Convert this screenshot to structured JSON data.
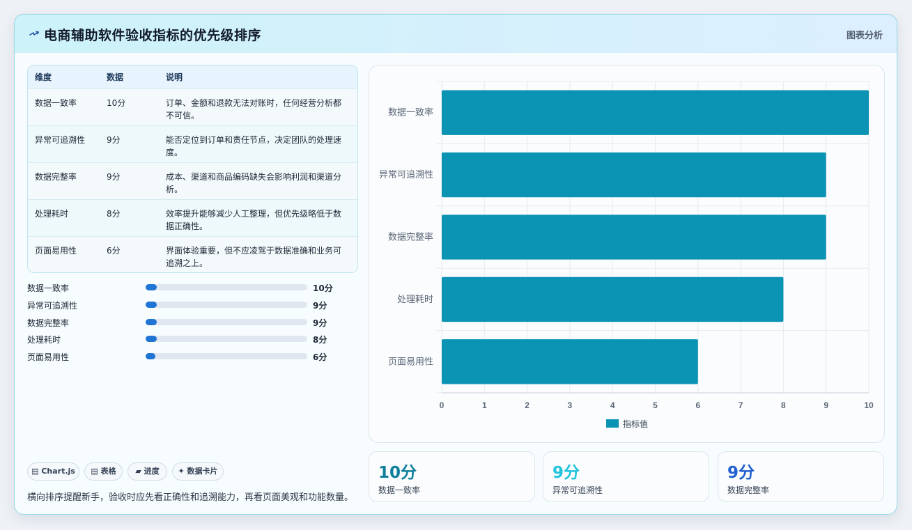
{
  "header": {
    "title": "电商辅助软件验收指标的优先级排序",
    "tag": "图表分析",
    "title_icon": "lightning-icon"
  },
  "table": {
    "headers": [
      "维度",
      "数据",
      "说明"
    ],
    "rows": [
      {
        "dimension": "数据一致率",
        "value": "10分",
        "desc": "订单、金额和退款无法对账时，任何经营分析都不可信。"
      },
      {
        "dimension": "异常可追溯性",
        "value": "9分",
        "desc": "能否定位到订单和责任节点，决定团队的处理速度。"
      },
      {
        "dimension": "数据完整率",
        "value": "9分",
        "desc": "成本、渠道和商品编码缺失会影响利润和渠道分析。"
      },
      {
        "dimension": "处理耗时",
        "value": "8分",
        "desc": "效率提升能够减少人工整理，但优先级略低于数据正确性。"
      },
      {
        "dimension": "页面易用性",
        "value": "6分",
        "desc": "界面体验重要，但不应凌驾于数据准确和业务可追溯之上。"
      }
    ]
  },
  "progress": [
    {
      "label": "数据一致率",
      "value": "10分",
      "fraction": 0.07
    },
    {
      "label": "异常可追溯性",
      "value": "9分",
      "fraction": 0.07
    },
    {
      "label": "数据完整率",
      "value": "9分",
      "fraction": 0.07
    },
    {
      "label": "处理耗时",
      "value": "8分",
      "fraction": 0.07
    },
    {
      "label": "页面易用性",
      "value": "6分",
      "fraction": 0.06
    }
  ],
  "chips": [
    "▤ Chart.js",
    "▤ 表格",
    "▰ 进度",
    "✦ 数据卡片"
  ],
  "footnote": "横向排序提醒新手，验收时应先看正确性和追溯能力，再看页面美观和功能数量。",
  "stats": [
    {
      "value": "10分",
      "label": "数据一致率",
      "color": "#0e7f9c"
    },
    {
      "value": "9分",
      "label": "异常可追溯性",
      "color": "#22c3dc"
    },
    {
      "value": "9分",
      "label": "数据完整率",
      "color": "#1f5fd0"
    }
  ],
  "colors": {
    "bar": "#0b93b3",
    "progress": "#1f74d4"
  },
  "chart_data": {
    "type": "bar",
    "orientation": "horizontal",
    "categories": [
      "数据一致率",
      "异常可追溯性",
      "数据完整率",
      "处理耗时",
      "页面易用性"
    ],
    "series": [
      {
        "name": "指标值",
        "values": [
          10,
          9,
          9,
          8,
          6
        ]
      }
    ],
    "xlim": [
      0,
      10
    ],
    "xticks": [
      "0",
      "1",
      "2",
      "3",
      "4",
      "5",
      "6",
      "7",
      "8",
      "9",
      "10"
    ],
    "grid": true,
    "legend": "bottom"
  }
}
